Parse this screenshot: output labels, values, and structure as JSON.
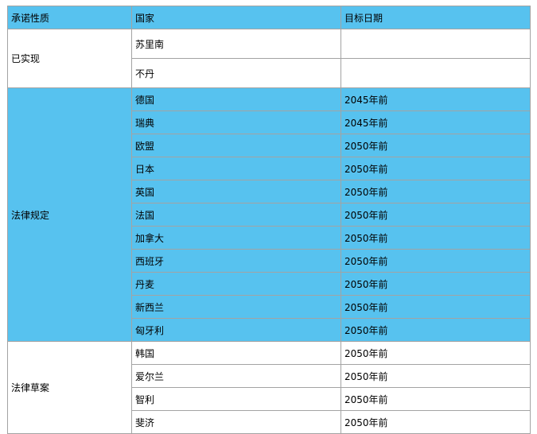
{
  "headers": [
    "承诺性质",
    "国家",
    "目标日期"
  ],
  "groups": [
    {
      "category": "已实现",
      "color": "white",
      "rows": [
        {
          "country": "苏里南",
          "date": ""
        },
        {
          "country": "不丹",
          "date": ""
        }
      ]
    },
    {
      "category": "法律规定",
      "color": "blue",
      "rows": [
        {
          "country": "德国",
          "date": "2045年前"
        },
        {
          "country": "瑞典",
          "date": "2045年前"
        },
        {
          "country": "欧盟",
          "date": "2050年前"
        },
        {
          "country": "日本",
          "date": "2050年前"
        },
        {
          "country": "英国",
          "date": "2050年前"
        },
        {
          "country": "法国",
          "date": "2050年前"
        },
        {
          "country": "加拿大",
          "date": "2050年前"
        },
        {
          "country": "西班牙",
          "date": "2050年前"
        },
        {
          "country": "丹麦",
          "date": "2050年前"
        },
        {
          "country": "新西兰",
          "date": "2050年前"
        },
        {
          "country": "匈牙利",
          "date": "2050年前"
        }
      ]
    },
    {
      "category": "法律草案",
      "color": "white",
      "rows": [
        {
          "country": "韩国",
          "date": "2050年前"
        },
        {
          "country": "爱尔兰",
          "date": "2050年前"
        },
        {
          "country": "智利",
          "date": "2050年前"
        },
        {
          "country": "斐济",
          "date": "2050年前"
        }
      ]
    }
  ],
  "colors": {
    "header": "#57c2ef",
    "blue_row": "#57c2ef",
    "white_row": "#ffffff",
    "border": "#a3a3a3"
  }
}
